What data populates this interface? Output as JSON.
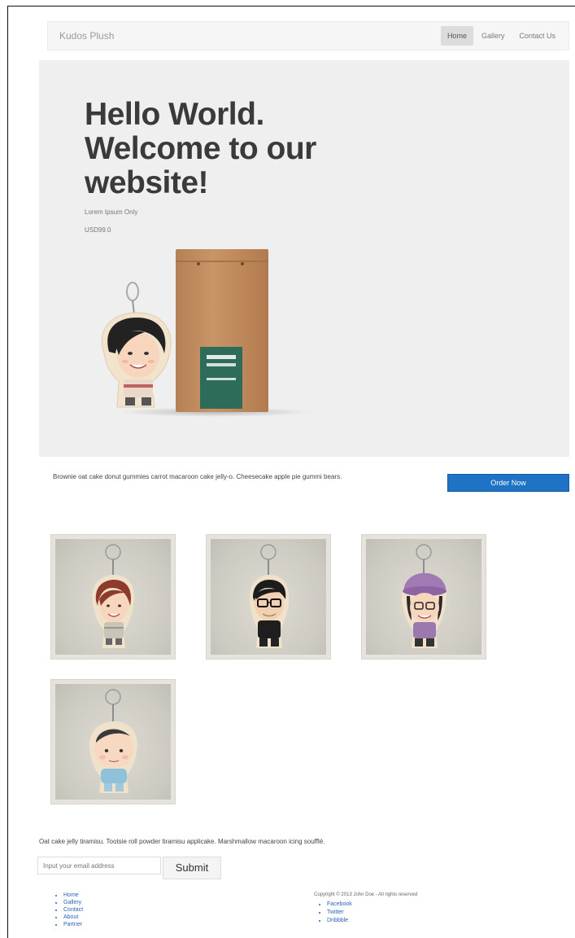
{
  "nav": {
    "brand": "Kudos Plush",
    "items": [
      {
        "label": "Home",
        "active": true
      },
      {
        "label": "Gallery",
        "active": false
      },
      {
        "label": "Contact Us",
        "active": false
      }
    ]
  },
  "hero": {
    "title": "Hello World. Welcome to our website!",
    "subtitle": "Lorem Ipsum Only",
    "price": "USD99.0"
  },
  "order": {
    "text": "Brownie oat cake donut gummies carrot macaroon cake jelly-o. Cheesecake apple pie gummi bears.",
    "button_label": "Order Now"
  },
  "gallery": {
    "items": [
      {
        "name": "keychain-girl-red-hair"
      },
      {
        "name": "keychain-boy-glasses"
      },
      {
        "name": "keychain-girl-purple-hat"
      },
      {
        "name": "keychain-baby"
      }
    ]
  },
  "newsletter": {
    "text": "Oat cake jelly tiramisu. Tootsie roll powder tiramisu applicake. Marshmallow macaroon icing soufflé.",
    "email_placeholder": "Input your email address",
    "submit_label": "Submit"
  },
  "footer": {
    "links": [
      "Home",
      "Gallery",
      "Contact",
      "About",
      "Partner"
    ],
    "copyright": "Copyright © 2013 John Doe - All rights reserved",
    "social": [
      "Facebook",
      "Twitter",
      "Dribbble"
    ]
  },
  "colors": {
    "accent": "#1f73c4",
    "hero_bg": "#efefef",
    "link": "#2a63b8"
  }
}
